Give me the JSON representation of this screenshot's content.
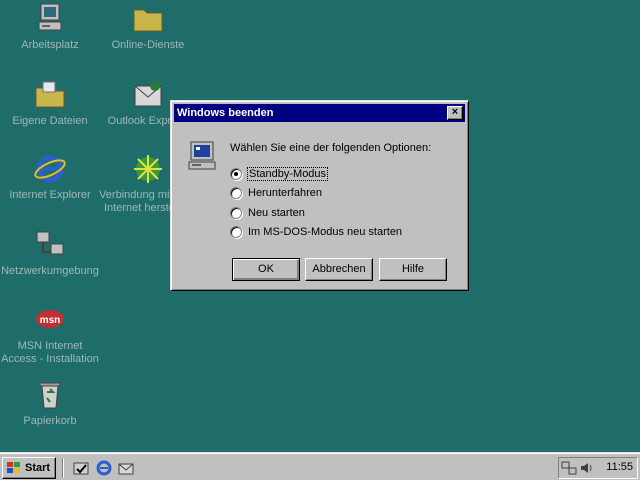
{
  "desktop": {
    "icons": [
      {
        "label": "Arbeitsplatz"
      },
      {
        "label": "Online-Dienste"
      },
      {
        "label": "Eigene Dateien"
      },
      {
        "label": "Outlook Express"
      },
      {
        "label": "Internet Explorer"
      },
      {
        "label": "Verbindung mit dem\nInternet herstellen"
      },
      {
        "label": "Netzwerkumgebung"
      },
      {
        "label": "MSN Internet\nAccess - Installation"
      },
      {
        "label": "Papierkorb"
      }
    ]
  },
  "dialog": {
    "title": "Windows beenden",
    "close_label": "×",
    "prompt": "Wählen Sie eine der folgenden Optionen:",
    "options": [
      {
        "label": "Standby-Modus",
        "checked": true
      },
      {
        "label": "Herunterfahren",
        "checked": false
      },
      {
        "label": "Neu starten",
        "checked": false
      },
      {
        "label": "Im MS-DOS-Modus neu starten",
        "checked": false
      }
    ],
    "buttons": {
      "ok": "OK",
      "cancel": "Abbrechen",
      "help": "Hilfe"
    }
  },
  "taskbar": {
    "start_label": "Start",
    "clock": "11:55"
  },
  "colors": {
    "desktop": "#1f6d6b",
    "titlebar": "#000080",
    "face": "#c0c0c0"
  }
}
